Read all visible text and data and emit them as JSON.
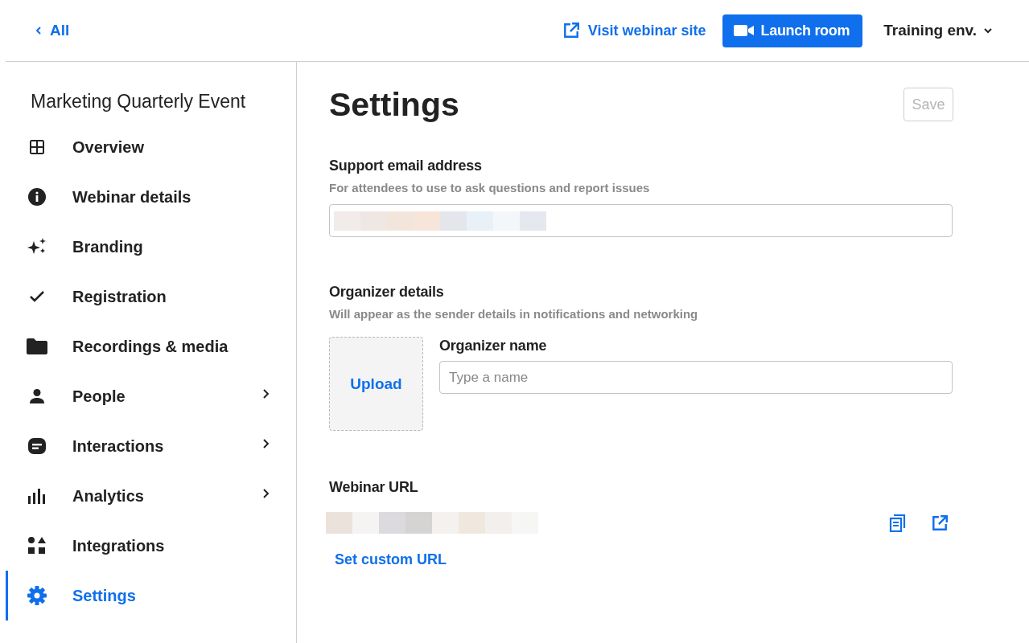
{
  "topbar": {
    "back_link": "All",
    "visit_link": "Visit webinar site",
    "launch_button": "Launch room",
    "environment": "Training env."
  },
  "sidebar": {
    "title": "Marketing Quarterly Event",
    "items": [
      {
        "label": "Overview",
        "expandable": false,
        "selected": false
      },
      {
        "label": "Webinar details",
        "expandable": false,
        "selected": false
      },
      {
        "label": "Branding",
        "expandable": false,
        "selected": false
      },
      {
        "label": "Registration",
        "expandable": false,
        "selected": false
      },
      {
        "label": "Recordings & media",
        "expandable": false,
        "selected": false
      },
      {
        "label": "People",
        "expandable": true,
        "selected": false
      },
      {
        "label": "Interactions",
        "expandable": true,
        "selected": false
      },
      {
        "label": "Analytics",
        "expandable": true,
        "selected": false
      },
      {
        "label": "Integrations",
        "expandable": false,
        "selected": false
      },
      {
        "label": "Settings",
        "expandable": false,
        "selected": true
      }
    ]
  },
  "main": {
    "title": "Settings",
    "save_button": {
      "label": "Save",
      "disabled": true
    },
    "support_email": {
      "label": "Support email address",
      "hint": "For attendees to use to ask questions and report issues"
    },
    "organizer": {
      "label": "Organizer details",
      "hint": "Will appear as the sender details in notifications and networking",
      "upload": "Upload",
      "name_label": "Organizer name",
      "name_placeholder": "Type a name"
    },
    "webinar_url": {
      "label": "Webinar URL",
      "custom_link": "Set custom URL"
    }
  }
}
